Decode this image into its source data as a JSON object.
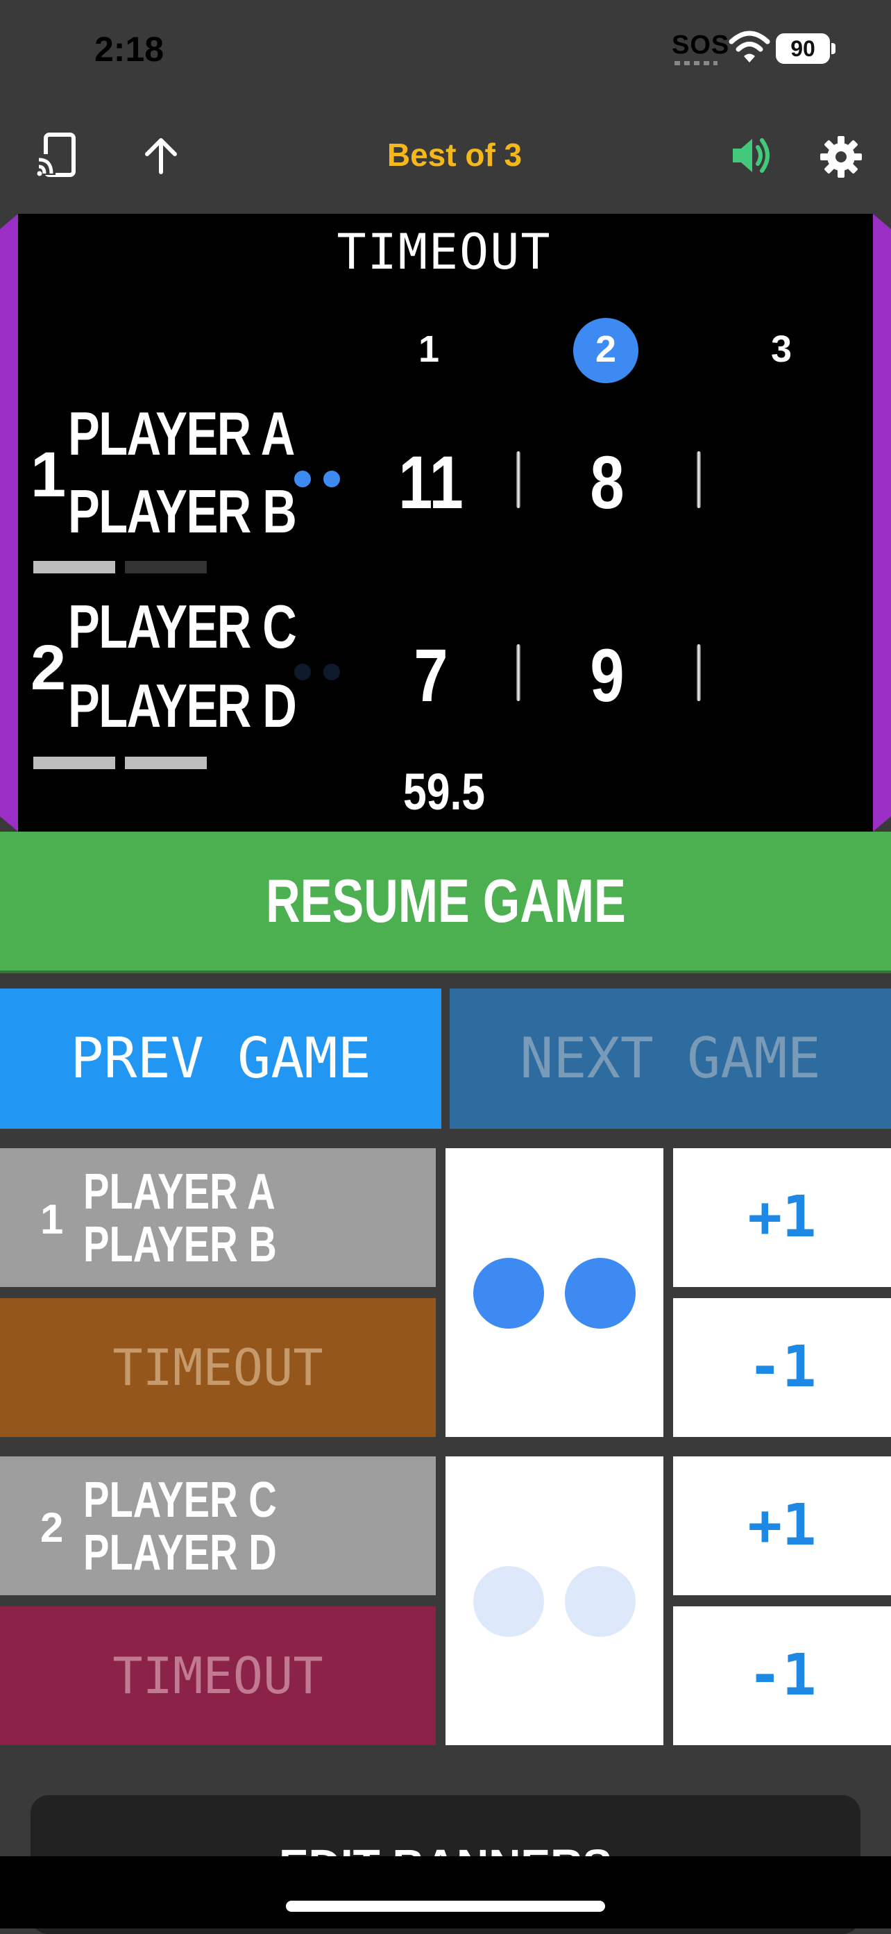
{
  "status_bar": {
    "time": "2:18",
    "sos": "SOS",
    "battery": "90"
  },
  "toolbar": {
    "title": "Best of 3",
    "cast_icon": "cast-icon",
    "upload_icon": "arrow-up-icon",
    "volume_icon": "speaker-icon",
    "settings_icon": "gear-icon"
  },
  "colors": {
    "accent_yellow": "#f5b81b",
    "volume_green": "#43c97a",
    "side_purple": "#9b2ec4",
    "blue": "#3d8bf2",
    "resume_green": "#4caf50",
    "prev_blue": "#2196f3",
    "next_blue": "#2e6b9e",
    "timeout_team1": "#94561a",
    "timeout_team2": "#8a2347"
  },
  "scoreboard": {
    "status": "TIMEOUT",
    "games": [
      "1",
      "2",
      "3"
    ],
    "current_game": "2",
    "teams": [
      {
        "number": "1",
        "player1": "PLAYER A",
        "player2": "PLAYER B",
        "scores": [
          "11",
          "8",
          ""
        ]
      },
      {
        "number": "2",
        "player1": "PLAYER C",
        "player2": "PLAYER D",
        "scores": [
          "7",
          "9",
          ""
        ]
      }
    ],
    "timer": "59.5"
  },
  "controls": {
    "resume": "RESUME GAME",
    "prev_game": "PREV GAME",
    "next_game": "NEXT GAME",
    "team1": {
      "number": "1",
      "player1": "PLAYER A",
      "player2": "PLAYER B",
      "timeout": "TIMEOUT",
      "plus": "+1",
      "minus": "-1"
    },
    "team2": {
      "number": "2",
      "player1": "PLAYER C",
      "player2": "PLAYER D",
      "timeout": "TIMEOUT",
      "plus": "+1",
      "minus": "-1"
    }
  },
  "edit_banners": "EDIT BANNERS"
}
